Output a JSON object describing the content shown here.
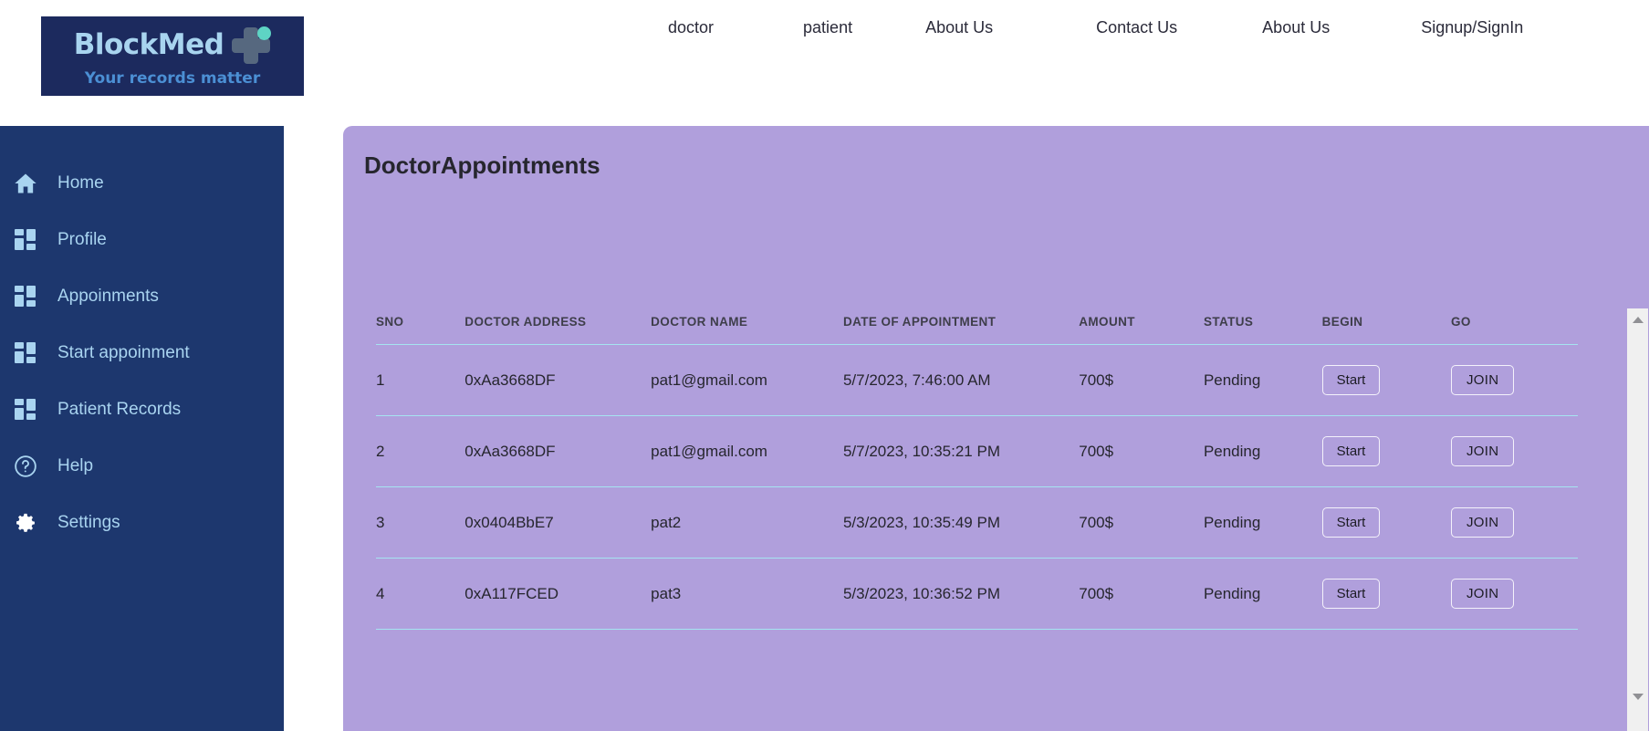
{
  "brand": {
    "name": "BlockMed",
    "tagline": "Your records matter"
  },
  "nav": {
    "items": [
      {
        "label": "doctor"
      },
      {
        "label": "patient"
      },
      {
        "label": "About Us"
      },
      {
        "label": "Contact Us"
      },
      {
        "label": "About Us"
      },
      {
        "label": "Signup/SignIn"
      }
    ]
  },
  "sidebar": {
    "items": [
      {
        "label": "Home",
        "icon": "home-icon"
      },
      {
        "label": "Profile",
        "icon": "dashboard-grid-icon"
      },
      {
        "label": "Appoinments",
        "icon": "dashboard-grid-icon"
      },
      {
        "label": "Start appoinment",
        "icon": "dashboard-grid-icon"
      },
      {
        "label": "Patient Records",
        "icon": "dashboard-grid-icon"
      },
      {
        "label": "Help",
        "icon": "help-circle-icon"
      },
      {
        "label": "Settings",
        "icon": "gear-icon"
      }
    ]
  },
  "panel": {
    "title": "DoctorAppointments"
  },
  "table": {
    "headers": [
      "SNO",
      "DOCTOR ADDRESS",
      "DOCTOR NAME",
      "DATE OF APPOINTMENT",
      "AMOUNT",
      "STATUS",
      "BEGIN",
      "GO"
    ],
    "rows": [
      {
        "sno": "1",
        "doctor_address": "0xAa3668DF",
        "doctor_name": "pat1@gmail.com",
        "date": "5/7/2023, 7:46:00 AM",
        "amount": "700$",
        "status": "Pending",
        "begin_label": "Start",
        "go_label": "JOIN"
      },
      {
        "sno": "2",
        "doctor_address": "0xAa3668DF",
        "doctor_name": "pat1@gmail.com",
        "date": "5/7/2023, 10:35:21 PM",
        "amount": "700$",
        "status": "Pending",
        "begin_label": "Start",
        "go_label": "JOIN"
      },
      {
        "sno": "3",
        "doctor_address": "0x0404BbE7",
        "doctor_name": "pat2",
        "date": "5/3/2023, 10:35:49 PM",
        "amount": "700$",
        "status": "Pending",
        "begin_label": "Start",
        "go_label": "JOIN"
      },
      {
        "sno": "4",
        "doctor_address": "0xA117FCED",
        "doctor_name": "pat3",
        "date": "5/3/2023, 10:36:52 PM",
        "amount": "700$",
        "status": "Pending",
        "begin_label": "Start",
        "go_label": "JOIN"
      }
    ]
  },
  "colors": {
    "sidebar_navy": "#1d376e",
    "logo_navy": "#1c2a5e",
    "panel_purple": "#b09fdc",
    "row_divider": "#a5e4f0",
    "sidebar_text": "#a9d4f0",
    "logo_accent_teal": "#5ed4c4"
  }
}
